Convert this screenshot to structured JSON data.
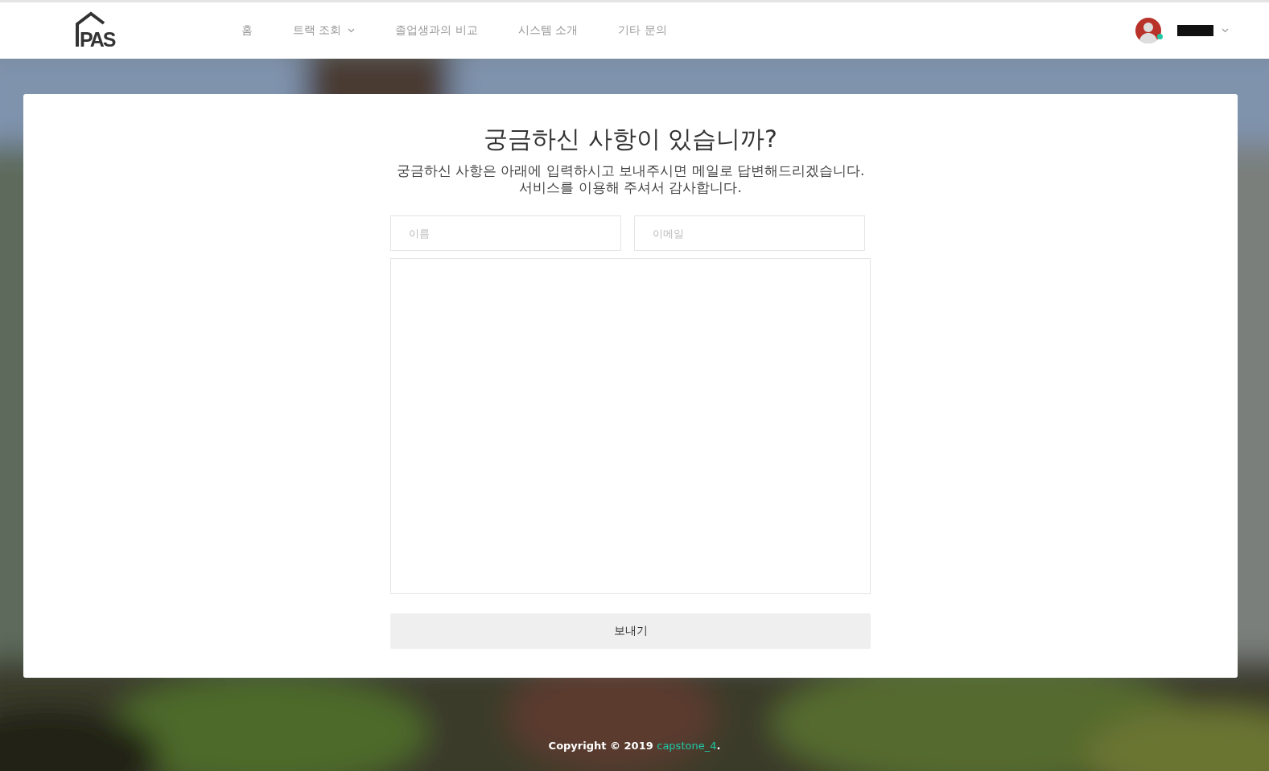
{
  "header": {
    "logo": "PAS",
    "nav": [
      {
        "label": "홈",
        "dropdown": false
      },
      {
        "label": "트랙 조회",
        "dropdown": true
      },
      {
        "label": "졸업생과의 비교",
        "dropdown": false
      },
      {
        "label": "시스템 소개",
        "dropdown": false
      },
      {
        "label": "기타 문의",
        "dropdown": false
      }
    ],
    "user": {
      "online": true
    }
  },
  "form": {
    "title": "궁금하신 사항이 있습니까?",
    "description": [
      "궁금하신 사항은 아래에 입력하시고 보내주시면 메일로 답변해드리겠습니다.",
      "서비스를 이용해 주셔서 감사합니다."
    ],
    "name_field": {
      "placeholder": "이름"
    },
    "email_field": {
      "placeholder": "이메일"
    },
    "submit": "보내기"
  },
  "footer": {
    "before": "Copyright © 2019 ",
    "link": "capstone_4",
    "after": "."
  }
}
